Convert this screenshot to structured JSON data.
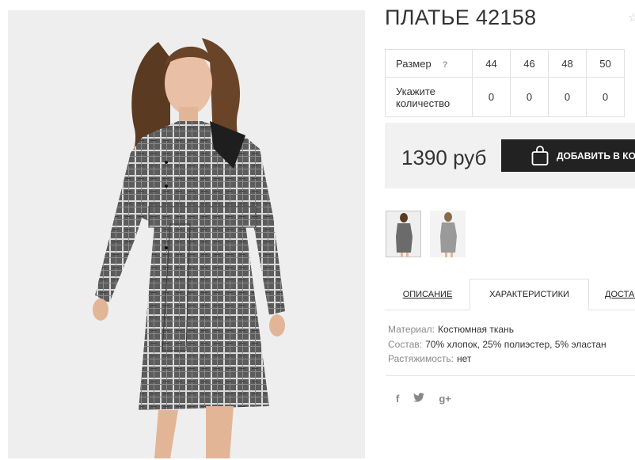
{
  "product": {
    "title": "ПЛАТЬЕ 42158",
    "wishlist_icon": "star-icon"
  },
  "size_table": {
    "size_label": "Размер",
    "help_icon": "?",
    "sizes": [
      "44",
      "46",
      "48",
      "50"
    ],
    "quantity_label": "Укажите количество",
    "quantities": [
      "0",
      "0",
      "0",
      "0"
    ]
  },
  "buy": {
    "price": "1390 руб",
    "add_to_cart_label": "ДОБАВИТЬ В КОРЗИНУ",
    "bag_icon": "shopping-bag-icon"
  },
  "thumbnails": [
    "thumbnail-front",
    "thumbnail-side"
  ],
  "tabs": {
    "description": "ОПИСАНИЕ",
    "characteristics": "ХАРАКТЕРИСТИКИ",
    "delivery": "ДОСТАВКА"
  },
  "specs": [
    {
      "key": "Материал:",
      "value": "Костюмная ткань"
    },
    {
      "key": "Состав:",
      "value": "70% хлопок, 25% полиэстер, 5% эластан"
    },
    {
      "key": "Растяжимость:",
      "value": "нет"
    }
  ],
  "social": {
    "facebook": "f",
    "twitter_icon": "twitter-icon",
    "googleplus": "g+"
  },
  "colors": {
    "button_bg": "#222222",
    "buy_box_bg": "#f1f1f1",
    "photo_bg": "#eeeeef"
  }
}
